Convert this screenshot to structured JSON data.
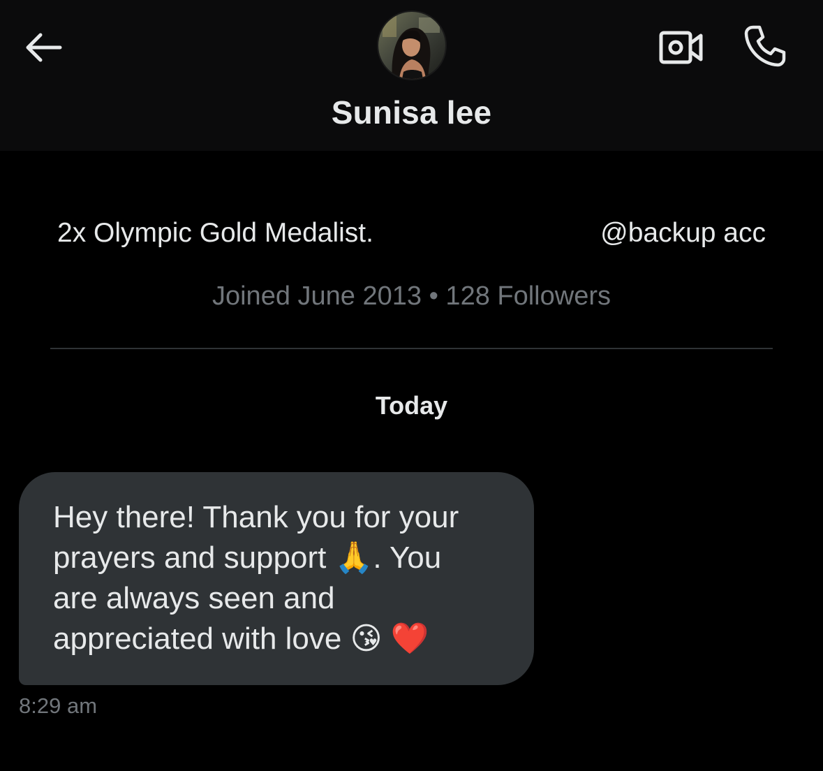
{
  "header": {
    "title": "Sunisa lee",
    "back_icon": "arrow-left-icon",
    "video_icon": "video-camera-icon",
    "call_icon": "phone-icon"
  },
  "profile": {
    "bio_left": "2x Olympic Gold Medalist.",
    "bio_right": "@backup acc",
    "joined_meta": "Joined June 2013 • 128 Followers"
  },
  "conversation": {
    "day_label": "Today",
    "messages": [
      {
        "text": "Hey there! Thank you for your\nprayers and support 🙏. You\nare always seen and\nappreciated with love 😘 ❤️",
        "time": "8:29 am"
      }
    ]
  },
  "colors": {
    "background": "#000000",
    "header_bg": "#0b0b0c",
    "bubble_bg": "#2f3336",
    "text_primary": "#e7e9ea",
    "text_secondary": "#71767b",
    "divider": "#2f3336"
  }
}
